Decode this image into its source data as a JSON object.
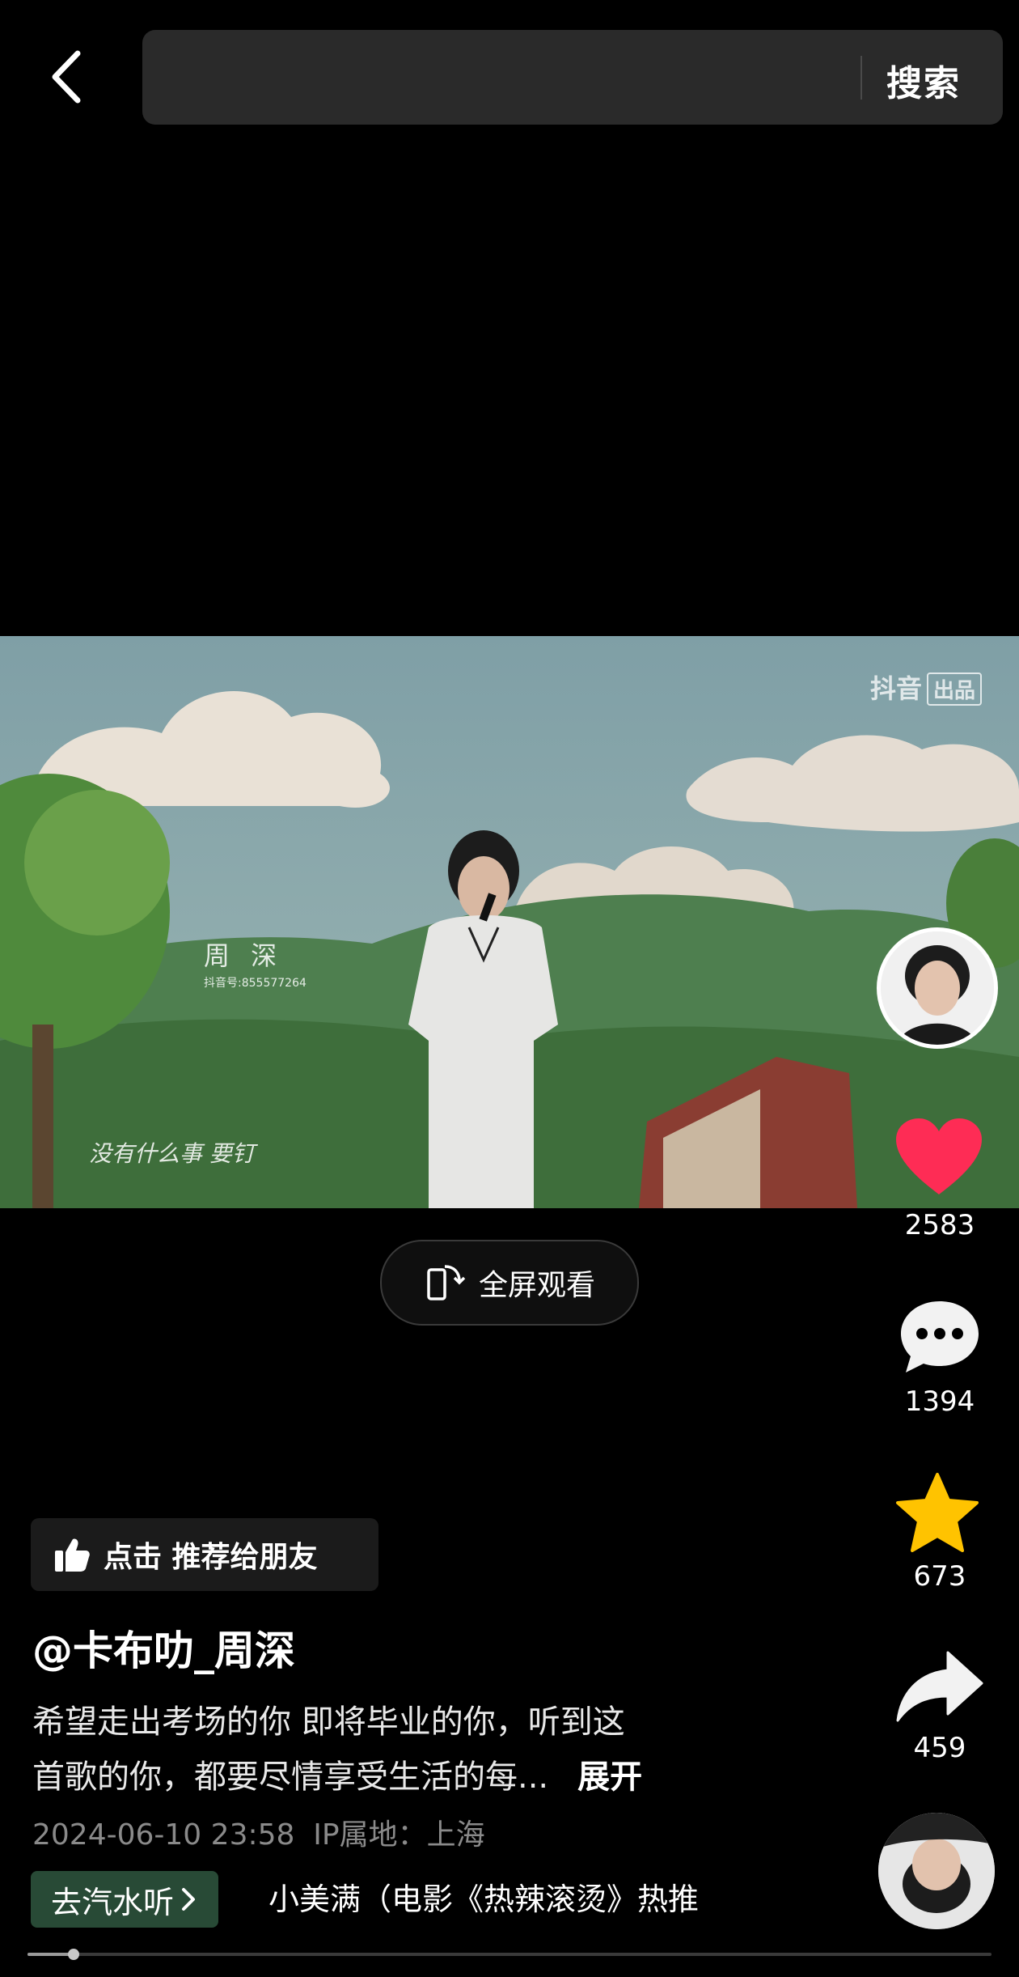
{
  "search": {
    "placeholder": "",
    "button_label": "搜索"
  },
  "video": {
    "watermark_brand": "抖音",
    "watermark_tag": "出品",
    "overlay_name": "周 深",
    "overlay_id": "抖音号:855577264",
    "overlay_handwriting": "没有什么事 要钉",
    "fullscreen_label": "全屏观看"
  },
  "actions": {
    "likes": "2583",
    "comments": "1394",
    "favorites": "673",
    "shares": "459"
  },
  "info": {
    "recommend_label": "点击 推荐给朋友",
    "author": "@卡布叻_周深",
    "description_line1": "希望走出考场的你 即将毕业的你，听到这",
    "description_line2": "首歌的你，都要尽情享受生活的每...",
    "expand_label": "展开",
    "datetime": "2024-06-10 23:58",
    "ip_location": "IP属地：上海",
    "music_button": "去汽水听",
    "music_title": "小美满（电影《热辣滚烫》热推"
  },
  "progress": {
    "fraction": 0.048
  },
  "colors": {
    "background": "#000000",
    "like_red": "#fe2c55",
    "favorite_yellow": "#ffc300",
    "music_green": "#284a36"
  }
}
